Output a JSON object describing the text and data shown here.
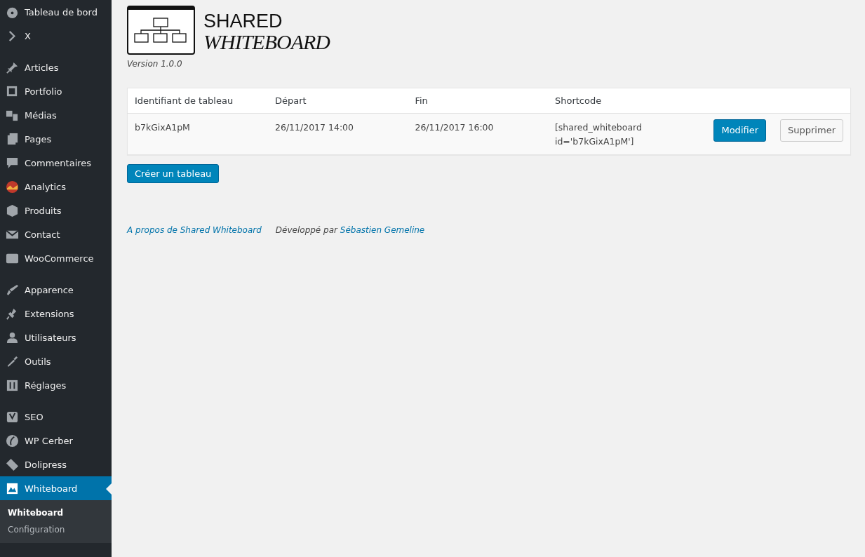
{
  "sidebar": {
    "groups": [
      [
        {
          "label": "Tableau de bord",
          "selected": false
        },
        {
          "label": "X",
          "selected": false
        }
      ],
      [
        {
          "label": "Articles",
          "selected": false
        },
        {
          "label": "Portfolio",
          "selected": false
        },
        {
          "label": "Médias",
          "selected": false
        },
        {
          "label": "Pages",
          "selected": false
        },
        {
          "label": "Commentaires",
          "selected": false
        },
        {
          "label": "Analytics",
          "selected": false
        },
        {
          "label": "Produits",
          "selected": false
        },
        {
          "label": "Contact",
          "selected": false
        },
        {
          "label": "WooCommerce",
          "selected": false
        }
      ],
      [
        {
          "label": "Apparence",
          "selected": false
        },
        {
          "label": "Extensions",
          "selected": false
        },
        {
          "label": "Utilisateurs",
          "selected": false
        },
        {
          "label": "Outils",
          "selected": false
        },
        {
          "label": "Réglages",
          "selected": false
        }
      ],
      [
        {
          "label": "SEO",
          "selected": false
        },
        {
          "label": "WP Cerber",
          "selected": false
        },
        {
          "label": "Dolipress",
          "selected": false
        },
        {
          "label": "Whiteboard",
          "selected": true,
          "submenu": [
            {
              "label": "Whiteboard",
              "selected": true
            },
            {
              "label": "Configuration",
              "selected": false
            }
          ]
        }
      ]
    ]
  },
  "header": {
    "title_line_1": "SHARED",
    "title_line_2": "WHITEBOARD",
    "version": "Version 1.0.0"
  },
  "table": {
    "columns": [
      "Identifiant de tableau",
      "Départ",
      "Fin",
      "Shortcode"
    ],
    "rows": [
      {
        "cells": [
          "b7kGixA1pM",
          "26/11/2017 14:00",
          "26/11/2017 16:00",
          "[shared_whiteboard id='b7kGixA1pM']"
        ],
        "edit_button": "Modifier",
        "delete_button": "Supprimer"
      }
    ]
  },
  "create_button": "Créer un tableau",
  "footer": {
    "about_link": "A propos de Shared Whiteboard",
    "credit": "Développé par",
    "author_link": "Sébastien Gemeline"
  }
}
